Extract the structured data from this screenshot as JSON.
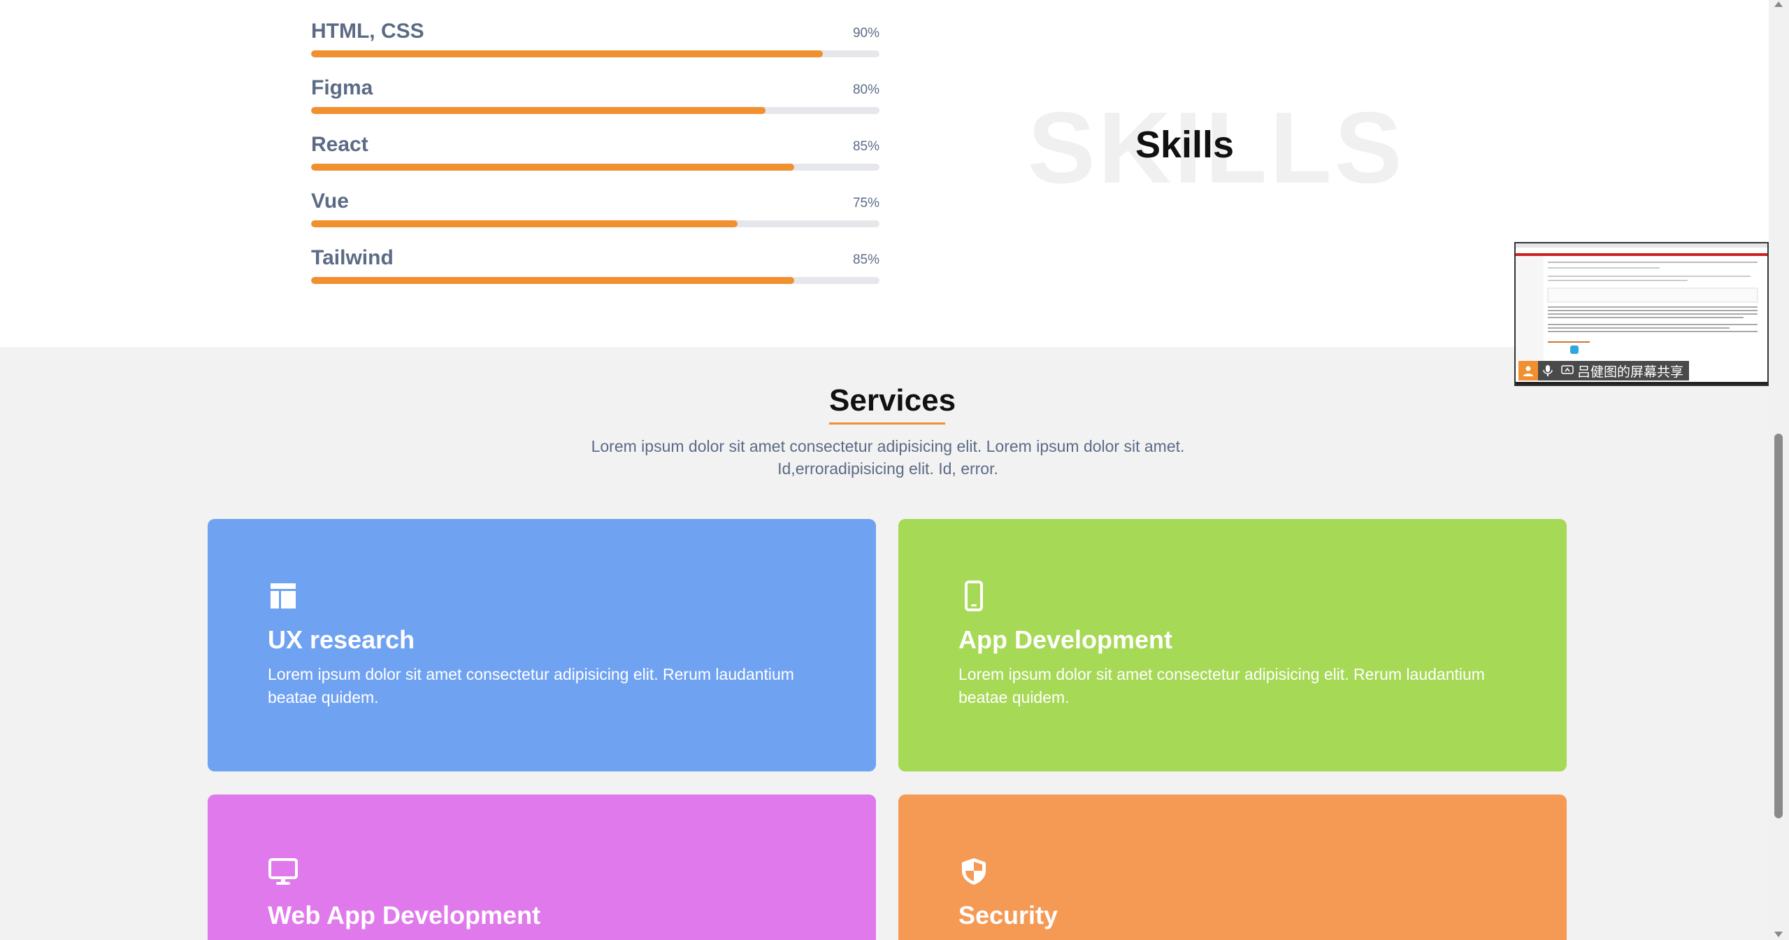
{
  "skills": {
    "heading": "Skills",
    "background_word": "SKILLS",
    "items": [
      {
        "name": "HTML, CSS",
        "percent_label": "90%",
        "level": 0.9
      },
      {
        "name": "Figma",
        "percent_label": "80%",
        "level": 0.8
      },
      {
        "name": "React",
        "percent_label": "85%",
        "level": 0.85
      },
      {
        "name": "Vue",
        "percent_label": "75%",
        "level": 0.75
      },
      {
        "name": "Tailwind",
        "percent_label": "85%",
        "level": 0.85
      }
    ],
    "bar_color": "#f0902f"
  },
  "services": {
    "title": "Services",
    "description": "Lorem ipsum dolor sit amet consectetur adipisicing elit. Lorem ipsum dolor sit amet. Id,erroradipisicing elit. Id, error.",
    "cards": [
      {
        "icon": "layout-icon",
        "title": "UX research",
        "text": "Lorem ipsum dolor sit amet consectetur adipisicing elit. Rerum laudantium beatae quidem.",
        "color": "#70a2f2"
      },
      {
        "icon": "mobile-icon",
        "title": "App Development",
        "text": "Lorem ipsum dolor sit amet consectetur adipisicing elit. Rerum laudantium beatae quidem.",
        "color": "#a6d955"
      },
      {
        "icon": "desktop-icon",
        "title": "Web App Development",
        "color": "#e079ec"
      },
      {
        "icon": "shield-icon",
        "title": "Security",
        "color": "#f59a55"
      }
    ]
  },
  "screen_share": {
    "label": "吕健图的屏幕共享"
  }
}
